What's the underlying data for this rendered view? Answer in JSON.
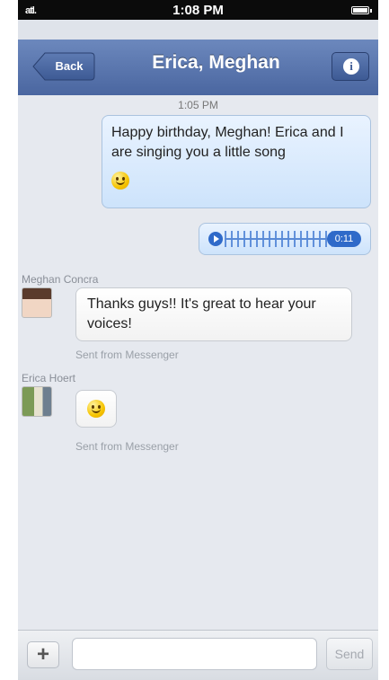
{
  "status_bar": {
    "signal": "atl.",
    "time": "1:08 PM"
  },
  "nav": {
    "back_label": "Back",
    "title": "Erica, Meghan",
    "info_label": "i"
  },
  "chat": {
    "timestamp": "1:05 PM",
    "outgoing_text": "Happy birthday, Meghan! Erica and I are singing you a little song",
    "audio": {
      "duration": "0:11"
    },
    "incoming": [
      {
        "sender": "Meghan Concra",
        "text": "Thanks guys!! It's great to hear your voices!",
        "meta": "Sent from Messenger"
      },
      {
        "sender": "Erica Hoert",
        "meta": "Sent from Messenger"
      }
    ]
  },
  "input": {
    "plus_label": "+",
    "placeholder": "",
    "send_label": "Send"
  },
  "colors": {
    "nav_top": "#6c88bd",
    "nav_bottom": "#4a66a0",
    "accent_blue": "#2f6ac9",
    "chat_bg": "#e6e9ef"
  },
  "icons": [
    "back-arrow-icon",
    "info-icon",
    "play-icon",
    "smiley-icon",
    "plus-icon",
    "battery-icon",
    "signal-icon"
  ]
}
